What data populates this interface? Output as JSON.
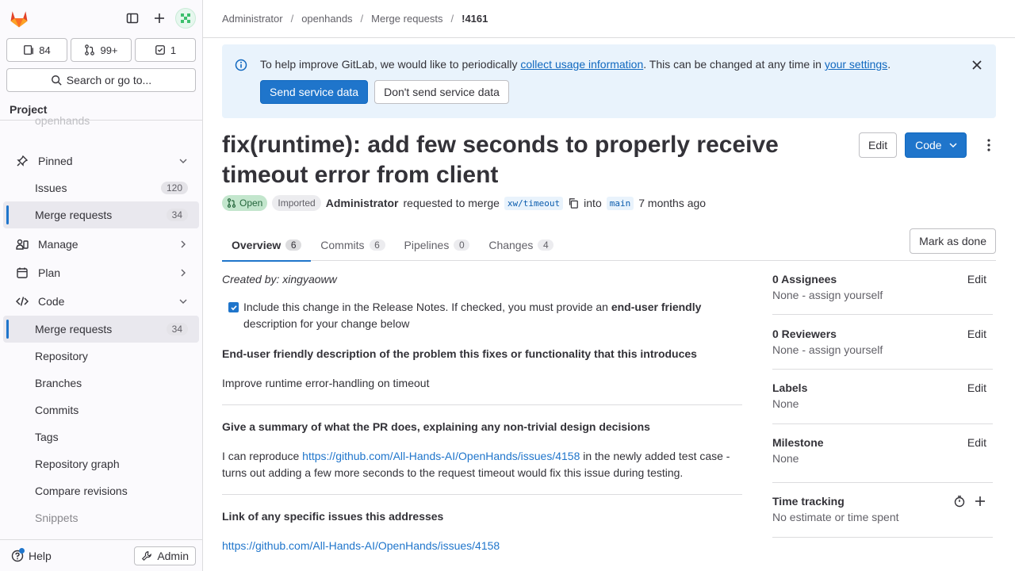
{
  "sidebar": {
    "counts": [
      {
        "icon": "issues-icon",
        "value": "84"
      },
      {
        "icon": "merge-request-icon",
        "value": "99+"
      },
      {
        "icon": "todo-icon",
        "value": "1"
      }
    ],
    "search_label": "Search or go to...",
    "section_title": "Project",
    "project_name": "openhands",
    "items": [
      {
        "label": "Pinned",
        "type": "group"
      },
      {
        "label": "Issues",
        "badge": "120",
        "type": "sub"
      },
      {
        "label": "Merge requests",
        "badge": "34",
        "type": "sub-active"
      },
      {
        "label": "Manage",
        "type": "group"
      },
      {
        "label": "Plan",
        "type": "group"
      },
      {
        "label": "Code",
        "type": "group"
      },
      {
        "label": "Merge requests",
        "badge": "34",
        "type": "sub-active"
      },
      {
        "label": "Repository",
        "type": "sub"
      },
      {
        "label": "Branches",
        "type": "sub"
      },
      {
        "label": "Commits",
        "type": "sub"
      },
      {
        "label": "Tags",
        "type": "sub"
      },
      {
        "label": "Repository graph",
        "type": "sub"
      },
      {
        "label": "Compare revisions",
        "type": "sub"
      },
      {
        "label": "Snippets",
        "type": "sub"
      }
    ],
    "help_label": "Help",
    "admin_label": "Admin"
  },
  "breadcrumb": [
    "Administrator",
    "openhands",
    "Merge requests",
    "!4161"
  ],
  "alert": {
    "text_before": "To help improve GitLab, we would like to periodically ",
    "link1": "collect usage information",
    "text_middle": ". This can be changed at any time in ",
    "link2": "your settings",
    "text_after": ".",
    "primary_btn": "Send service data",
    "secondary_btn": "Don't send service data"
  },
  "mr": {
    "title": "fix(runtime): add few seconds to properly receive timeout error from client",
    "edit_label": "Edit",
    "code_label": "Code",
    "status": "Open",
    "imported": "Imported",
    "author": "Administrator",
    "requested_text": "requested to merge",
    "source_branch": "xw/timeout",
    "into_text": "into",
    "target_branch": "main",
    "time_ago": "7 months ago"
  },
  "tabs": [
    {
      "label": "Overview",
      "count": "6"
    },
    {
      "label": "Commits",
      "count": "6"
    },
    {
      "label": "Pipelines",
      "count": "0"
    },
    {
      "label": "Changes",
      "count": "4"
    }
  ],
  "mark_done_label": "Mark as done",
  "description": {
    "created_by": "Created by: xingyaoww",
    "checkbox_text_1": "Include this change in the Release Notes. If checked, you must provide an ",
    "checkbox_bold": "end-user friendly",
    "checkbox_text_2": " description for your change below",
    "h1": "End-user friendly description of the problem this fixes or functionality that this introduces",
    "p1": "Improve runtime error-handling on timeout",
    "h2": "Give a summary of what the PR does, explaining any non-trivial design decisions",
    "p2_before": "I can reproduce ",
    "p2_link": "https://github.com/All-Hands-AI/OpenHands/issues/4158",
    "p2_after": " in the newly added test case - turns out adding a few more seconds to the request timeout would fix this issue during testing.",
    "h3": "Link of any specific issues this addresses",
    "p3_link": "https://github.com/All-Hands-AI/OpenHands/issues/4158"
  },
  "right_sidebar": {
    "assignees": {
      "title": "0 Assignees",
      "edit": "Edit",
      "value": "None - assign yourself"
    },
    "reviewers": {
      "title": "0 Reviewers",
      "edit": "Edit",
      "value": "None - assign yourself"
    },
    "labels": {
      "title": "Labels",
      "edit": "Edit",
      "value": "None"
    },
    "milestone": {
      "title": "Milestone",
      "edit": "Edit",
      "value": "None"
    },
    "time_tracking": {
      "title": "Time tracking",
      "value": "No estimate or time spent"
    }
  }
}
